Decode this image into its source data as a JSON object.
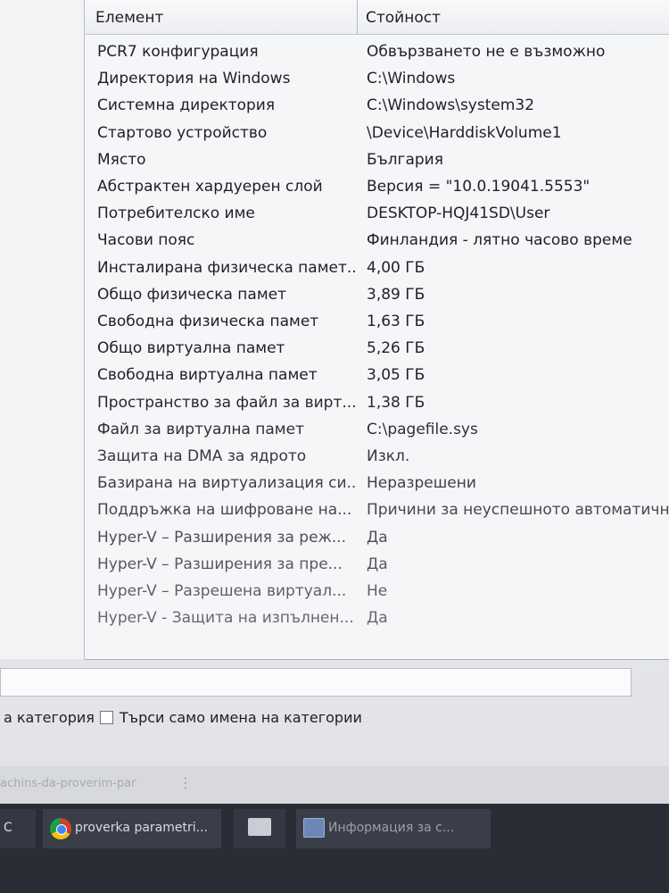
{
  "table": {
    "headers": {
      "element": "Елемент",
      "value": "Стойност"
    },
    "rows": [
      {
        "element": "PCR7 конфигурация",
        "value": "Обвързването не е възможно"
      },
      {
        "element": "Директория на Windows",
        "value": "C:\\Windows"
      },
      {
        "element": "Системна директория",
        "value": "C:\\Windows\\system32"
      },
      {
        "element": "Стартово устройство",
        "value": "\\Device\\HarddiskVolume1"
      },
      {
        "element": "Място",
        "value": "България"
      },
      {
        "element": "Абстрактен хардуерен слой",
        "value": "Версия = \"10.0.19041.5553\""
      },
      {
        "element": "Потребителско име",
        "value": "DESKTOP-HQJ41SD\\User"
      },
      {
        "element": "Часови пояс",
        "value": "Финландия - лятно часово време"
      },
      {
        "element": "Инсталирана физическа памет...",
        "value": "4,00 ГБ"
      },
      {
        "element": "Общо физическа памет",
        "value": "3,89 ГБ"
      },
      {
        "element": "Свободна физическа памет",
        "value": "1,63 ГБ"
      },
      {
        "element": "Общо виртуална памет",
        "value": "5,26 ГБ"
      },
      {
        "element": "Свободна виртуална памет",
        "value": "3,05 ГБ"
      },
      {
        "element": "Пространство за файл за вирт...",
        "value": "1,38 ГБ"
      },
      {
        "element": "Файл за виртуална памет",
        "value": "C:\\pagefile.sys"
      },
      {
        "element": "Защита на DMA за ядрото",
        "value": "Изкл."
      },
      {
        "element": "Базирана на виртуализация си...",
        "value": "Неразрешени"
      },
      {
        "element": "Поддръжка на шифроване на...",
        "value": "Причини за неуспешното автоматично"
      },
      {
        "element": "Hyper-V – Разширения за реж...",
        "value": "Да"
      },
      {
        "element": "Hyper-V – Разширения за пре...",
        "value": "Да"
      },
      {
        "element": "Hyper-V – Разрешена виртуал...",
        "value": "Не"
      },
      {
        "element": "Hyper-V - Защита на изпълнен...",
        "value": "Да"
      }
    ]
  },
  "search": {
    "value": "",
    "left_label": "а категория",
    "search_category_names_label": "Търси само имена на категории",
    "search_category_names_checked": false
  },
  "statusbar": {
    "text": "achins-da-proverim-par",
    "dots": "⋮"
  },
  "taskbar": {
    "partial_label": "C",
    "chrome_label": "proverka parametri...",
    "info_label": "Информация за с..."
  },
  "colors": {
    "text": "#1e1f22",
    "list_bg": "#f5f6f8",
    "taskbar_bg": "#2a2d35"
  }
}
